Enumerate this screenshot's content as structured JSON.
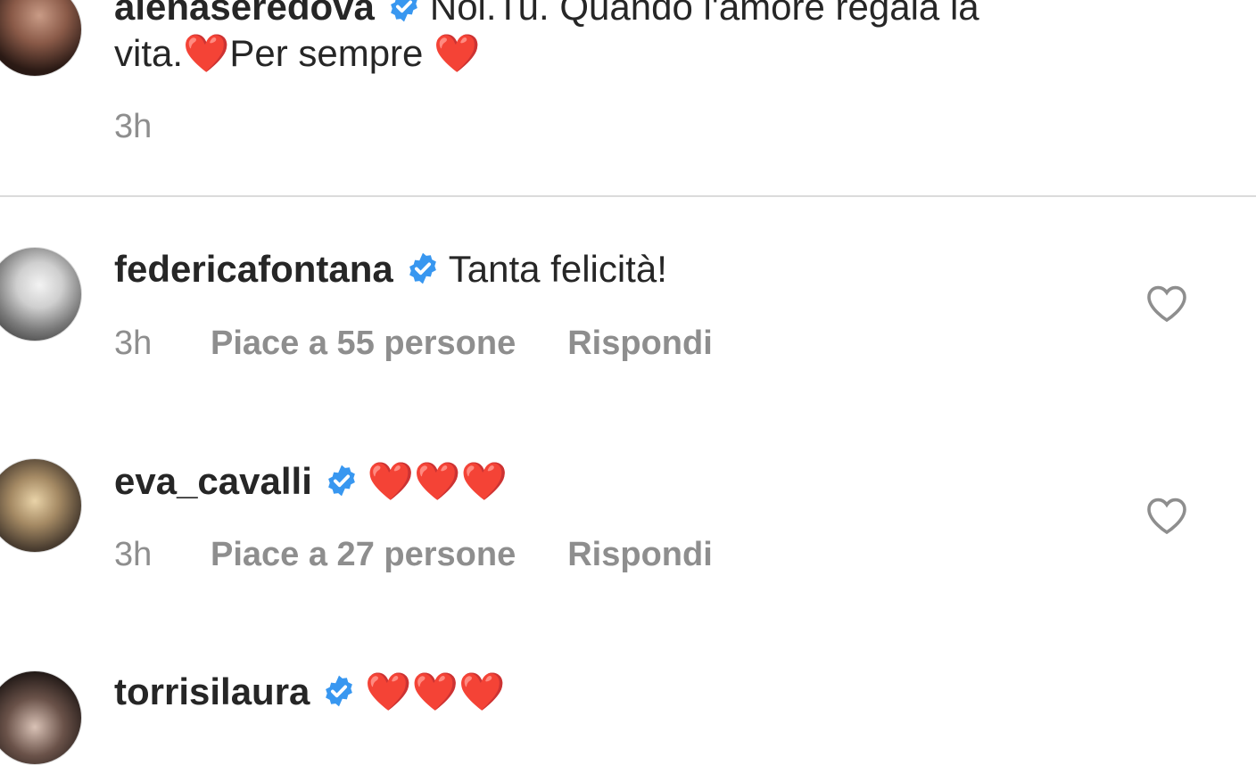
{
  "caption": {
    "username": "alenaseredova",
    "text_line1": "Noi.Tu. Quando l'amore regala la",
    "text_line2_part1": "vita.",
    "text_line2_part2": "Per sempre ",
    "heart": "❤️",
    "time": "3h"
  },
  "comments": [
    {
      "username": "federicafontana",
      "text": "Tanta felicità!",
      "time": "3h",
      "likes": "Piace a 55 persone",
      "reply": "Rispondi"
    },
    {
      "username": "eva_cavalli",
      "text": "❤️❤️❤️",
      "time": "3h",
      "likes": "Piace a 27 persone",
      "reply": "Rispondi"
    },
    {
      "username": "torrisilaura",
      "text": "❤️❤️❤️"
    }
  ],
  "colors": {
    "verified_badge": "#3897f0",
    "meta_text": "#8e8e8e",
    "primary_text": "#262626",
    "divider": "#dbdbdb"
  },
  "icons": {
    "verified": "verified-badge-icon",
    "like": "heart-outline-icon",
    "avatar": "user-avatar"
  }
}
